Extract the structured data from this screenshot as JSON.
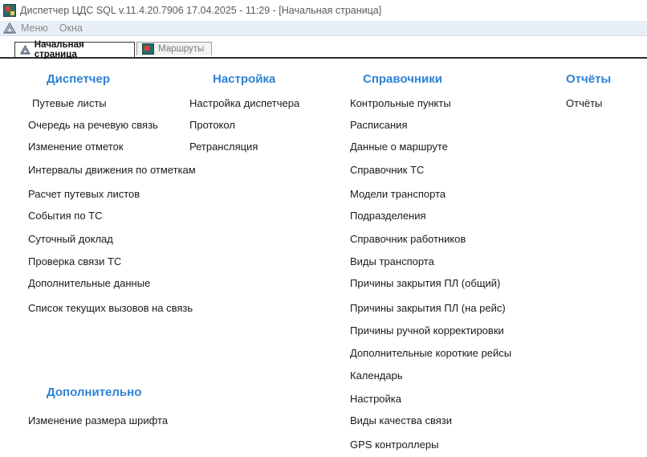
{
  "window": {
    "title": "Диспетчер ЦДС SQL  v.11.4.20.7906   17.04.2025 - 11:29 - [Начальная страница]"
  },
  "menu": {
    "items": [
      {
        "label": "Меню"
      },
      {
        "label": "Окна"
      }
    ]
  },
  "tabs": [
    {
      "label": "Начальная страница",
      "active": true
    },
    {
      "label": "Маршруты",
      "active": false
    }
  ],
  "sections": {
    "dispatcher": {
      "title": "Диспетчер",
      "items": [
        "Путевые листы",
        "Очередь на речевую связь",
        "Изменение отметок",
        "Интервалы движения по отметкам",
        "Расчет путевых листов",
        "События по ТС",
        "Суточный доклад",
        "Проверка связи ТС",
        "Дополнительные данные",
        "Список текущих вызовов на связь"
      ]
    },
    "settings": {
      "title": "Настройка",
      "items": [
        "Настройка диспетчера",
        "Протокол",
        "Ретрансляция"
      ]
    },
    "references": {
      "title": "Справочники",
      "items": [
        "Контрольные пункты",
        "Расписания",
        "Данные о маршруте",
        "Справочник ТС",
        "Модели транспорта",
        "Подразделения",
        "Справочник работников",
        "Виды транспорта",
        "Причины закрытия ПЛ (общий)",
        "Причины закрытия ПЛ (на рейс)",
        "Причины ручной корректировки",
        "Дополнительные короткие рейсы",
        "Календарь",
        "Настройка",
        "Виды качества связи",
        "GPS контроллеры"
      ]
    },
    "reports": {
      "title": "Отчёты",
      "items": [
        "Отчёты"
      ]
    },
    "additional": {
      "title": "Дополнительно",
      "items": [
        "Изменение размера шрифта"
      ]
    }
  },
  "colors": {
    "section_title": "#2d83d6",
    "menubar_bg": "#e9eff7"
  }
}
